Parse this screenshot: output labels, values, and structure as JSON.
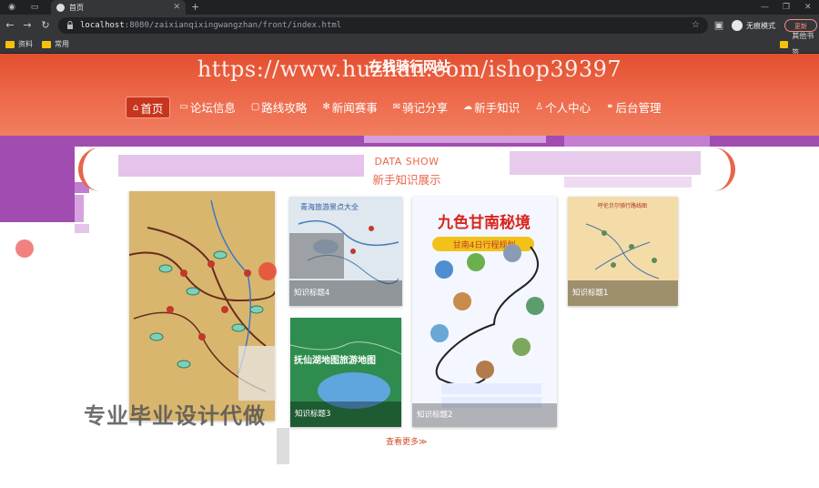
{
  "browser": {
    "tab_title": "首页",
    "url_host": "localhost",
    "url_rest": ":8080/zaixianqixingwangzhan/front/index.html",
    "incognito_label": "无痕模式",
    "update_label": "更新",
    "bookmarks": [
      "资料",
      "常用"
    ],
    "other_bookmarks": "其他书签"
  },
  "site": {
    "title": "在线骑行网站",
    "watermark": "https://www.huzhan.com/ishop39397",
    "nav": [
      {
        "label": "首页",
        "icon": "home-icon",
        "glyph": "⌂",
        "active": true
      },
      {
        "label": "论坛信息",
        "icon": "forum-icon",
        "glyph": "▭"
      },
      {
        "label": "路线攻略",
        "icon": "route-icon",
        "glyph": "▢"
      },
      {
        "label": "新闻赛事",
        "icon": "news-icon",
        "glyph": "✻"
      },
      {
        "label": "骑记分享",
        "icon": "share-icon",
        "glyph": "✉"
      },
      {
        "label": "新手知识",
        "icon": "knowledge-icon",
        "glyph": "☁"
      },
      {
        "label": "个人中心",
        "icon": "user-icon",
        "glyph": "♙"
      },
      {
        "label": "后台管理",
        "icon": "link-icon",
        "glyph": "⚭"
      }
    ]
  },
  "section": {
    "title_en": "DATA SHOW",
    "title_cn": "新手知识展示",
    "more": "查看更多≫"
  },
  "cards": [
    {
      "label": "知识标题1",
      "map_title": "呼伦贝尔骑行路线图"
    },
    {
      "label": "知识标题2",
      "poster_title": "九色甘南秘境",
      "poster_sub": "甘南4日行程规划"
    },
    {
      "label": "知识标题3",
      "map_title": "抚仙湖地图旅游地图"
    },
    {
      "label": "知识标题4",
      "map_title": "青海旅游景点大全"
    }
  ],
  "overlay": {
    "ad_text": "专业毕业设计代做"
  }
}
